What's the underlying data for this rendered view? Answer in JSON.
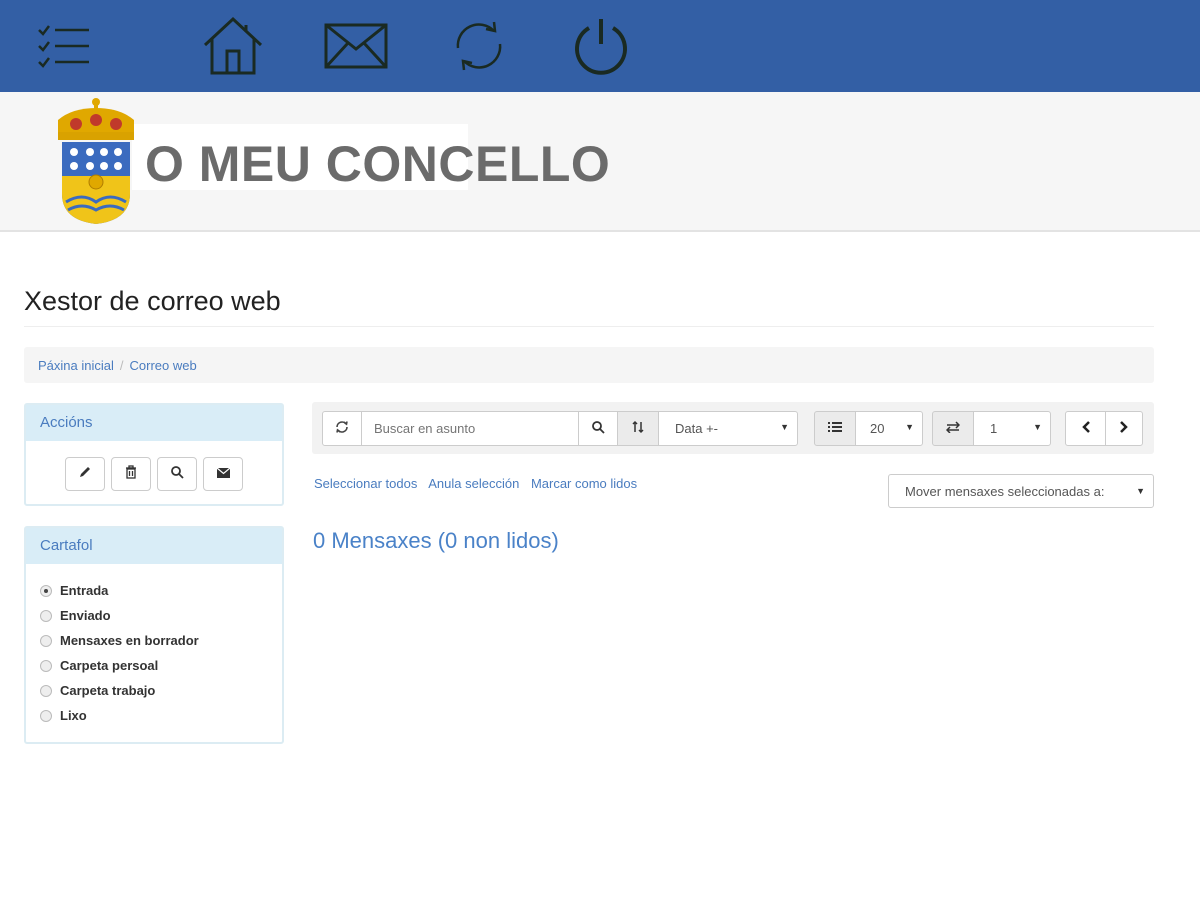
{
  "nav": {
    "icons": [
      "menu-list-icon",
      "home-icon",
      "mail-icon",
      "refresh-icon",
      "power-icon"
    ]
  },
  "banner": {
    "site_title": "O MEU CONCELLO"
  },
  "page": {
    "heading": "Xestor de correo web"
  },
  "breadcrumb": {
    "items": [
      "Páxina inicial",
      "Correo web"
    ],
    "separator": "/"
  },
  "actions_panel": {
    "title": "Accións",
    "buttons": [
      "pencil-icon",
      "trash-icon",
      "search-icon",
      "envelope-icon"
    ]
  },
  "folders_panel": {
    "title": "Cartafol",
    "items": [
      {
        "label": "Entrada",
        "selected": true
      },
      {
        "label": "Enviado",
        "selected": false
      },
      {
        "label": "Mensaxes en borrador",
        "selected": false
      },
      {
        "label": "Carpeta persoal",
        "selected": false
      },
      {
        "label": "Carpeta trabajo",
        "selected": false
      },
      {
        "label": "Lixo",
        "selected": false
      }
    ]
  },
  "toolbar": {
    "search_placeholder": "Buscar en asunto",
    "sort_value": "Data +-",
    "page_size_value": "20",
    "page_value": "1"
  },
  "selection_links": {
    "select_all": "Seleccionar todos",
    "clear_selection": "Anula selección",
    "mark_read": "Marcar como lidos"
  },
  "move_select": {
    "value": "Mover mensaxes seleccionadas a:"
  },
  "message_count": "0 Mensaxes (0 non lidos)",
  "colors": {
    "topbar": "#335fa5",
    "link": "#4a7cbf",
    "panel_head": "#d9edf7"
  }
}
